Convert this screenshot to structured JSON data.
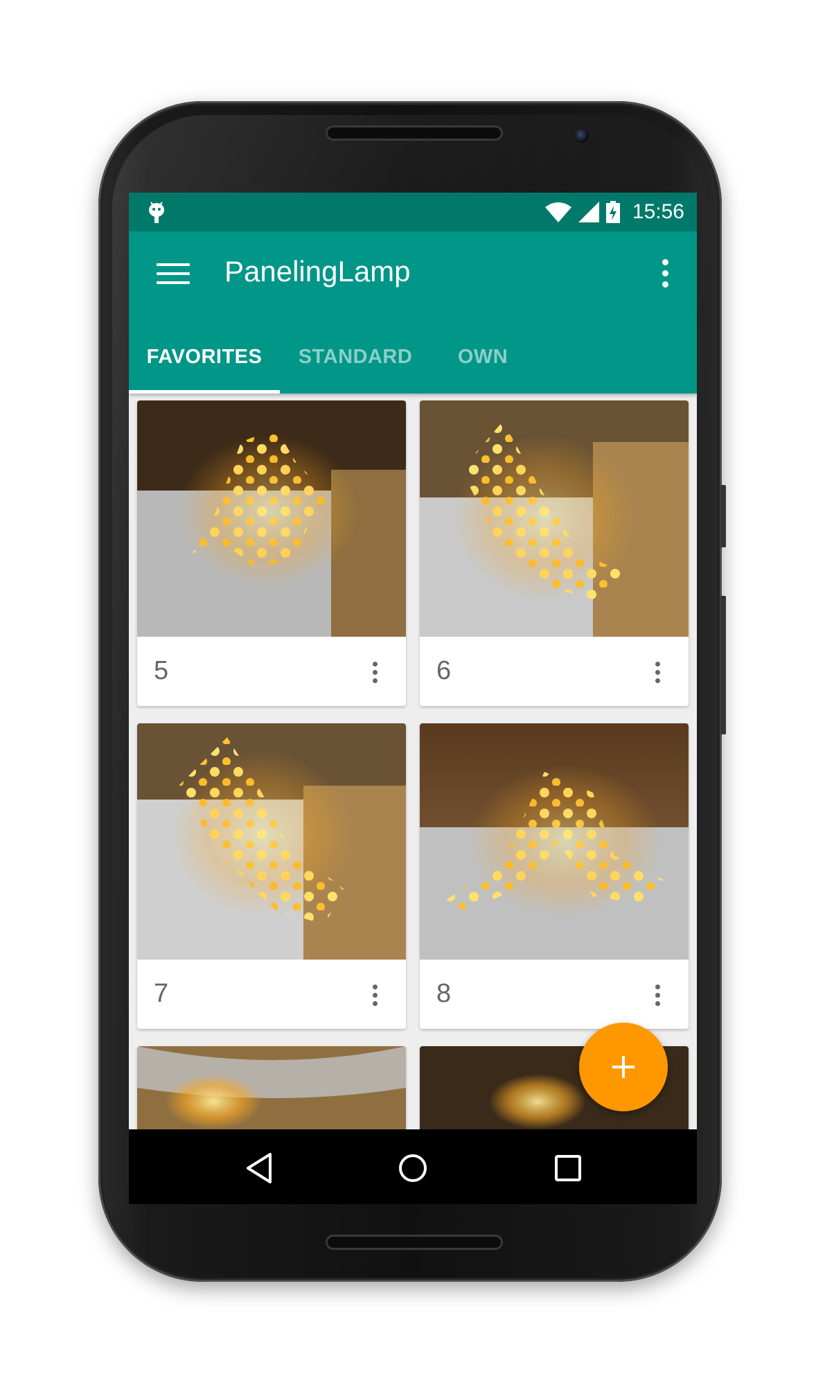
{
  "status_bar": {
    "time": "15:56",
    "icons": [
      "android-notification-icon",
      "wifi-icon",
      "signal-icon",
      "battery-charging-icon"
    ]
  },
  "toolbar": {
    "title": "PanelingLamp",
    "menu_icon": "menu-icon",
    "overflow_icon": "more-vert-icon"
  },
  "tabs": [
    {
      "label": "FAVORITES",
      "selected": true
    },
    {
      "label": "STANDARD",
      "selected": false
    },
    {
      "label": "OWN",
      "selected": false
    }
  ],
  "cards": [
    {
      "label": "5"
    },
    {
      "label": "6"
    },
    {
      "label": "7"
    },
    {
      "label": "8"
    }
  ],
  "fab": {
    "icon": "add-icon"
  },
  "nav_bar": {
    "icons": [
      "back-icon",
      "home-icon",
      "recents-icon"
    ]
  },
  "colors": {
    "primary": "#009688",
    "primary_dark": "#00796b",
    "accent": "#ff9800",
    "background": "#eeeeee"
  }
}
